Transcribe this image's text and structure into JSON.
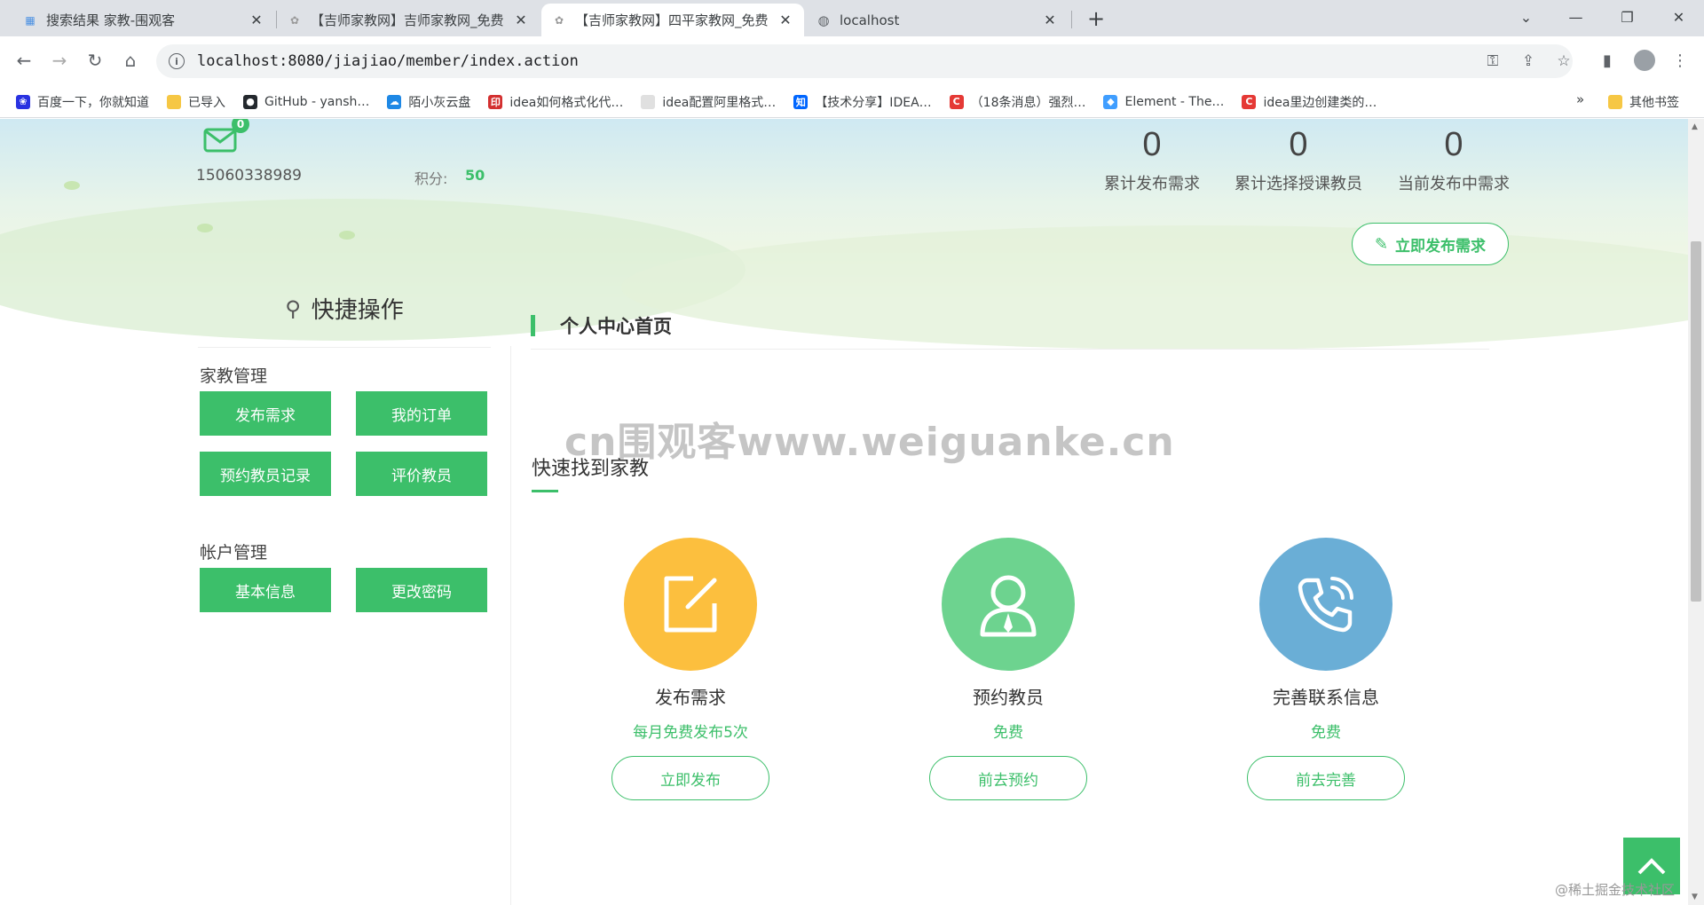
{
  "browser": {
    "tabs": [
      {
        "title": "搜索结果 家教-围观客",
        "favicon": "search-result-favicon"
      },
      {
        "title": "【吉师家教网】吉师家教网_免费",
        "favicon": "site-favicon"
      },
      {
        "title": "【吉师家教网】四平家教网_免费",
        "favicon": "site-favicon"
      },
      {
        "title": "localhost",
        "favicon": "globe-icon"
      }
    ],
    "active_tab": 2,
    "url": "localhost:8080/jiajiao/member/index.action",
    "bookmarks": [
      {
        "label": "百度一下，你就知道",
        "color": "#2932e1",
        "glyph": "❀"
      },
      {
        "label": "已导入",
        "color": "#f6c744",
        "glyph": ""
      },
      {
        "label": "GitHub - yansh…",
        "color": "#24292e",
        "glyph": "●"
      },
      {
        "label": "陌小灰云盘",
        "color": "#1e88e5",
        "glyph": "☁"
      },
      {
        "label": "idea如何格式化代…",
        "color": "#d32f2f",
        "glyph": "印"
      },
      {
        "label": "idea配置阿里格式…",
        "color": "#e0e0e0",
        "glyph": ""
      },
      {
        "label": "【技术分享】IDEA…",
        "color": "#0066ff",
        "glyph": "知"
      },
      {
        "label": "（18条消息）强烈…",
        "color": "#e53935",
        "glyph": "C"
      },
      {
        "label": "Element - The…",
        "color": "#409eff",
        "glyph": "◆"
      },
      {
        "label": "idea里边创建类的…",
        "color": "#e53935",
        "glyph": "C"
      }
    ],
    "bookmarks_more": "»",
    "other_bookmarks": "其他书签"
  },
  "user": {
    "mail_badge": "0",
    "phone": "15060338989",
    "points_label": "积分:",
    "points_value": "50"
  },
  "stats": [
    {
      "value": "0",
      "label": "累计发布需求"
    },
    {
      "value": "0",
      "label": "累计选择授课教员"
    },
    {
      "value": "0",
      "label": "当前发布中需求"
    }
  ],
  "publish_now_label": "立即发布需求",
  "quick_ops": {
    "title": "快捷操作",
    "groups": [
      {
        "title": "家教管理",
        "buttons": [
          "发布需求",
          "我的订单",
          "预约教员记录",
          "评价教员"
        ]
      },
      {
        "title": "帐户管理",
        "buttons": [
          "基本信息",
          "更改密码"
        ]
      }
    ]
  },
  "main": {
    "title": "个人中心首页",
    "subheading": "快速找到家教",
    "features": [
      {
        "title": "发布需求",
        "subtitle": "每月免费发布5次",
        "button": "立即发布",
        "color": "#fcbf3e",
        "icon": "edit-icon"
      },
      {
        "title": "预约教员",
        "subtitle": "免费",
        "button": "前去预约",
        "color": "#6dd38f",
        "icon": "teacher-icon"
      },
      {
        "title": "完善联系信息",
        "subtitle": "免费",
        "button": "前去完善",
        "color": "#6aaed6",
        "icon": "phone-icon"
      }
    ]
  },
  "watermark": "cn围观客www.weiguanke.cn",
  "footnote": "@稀土掘金技术社区"
}
